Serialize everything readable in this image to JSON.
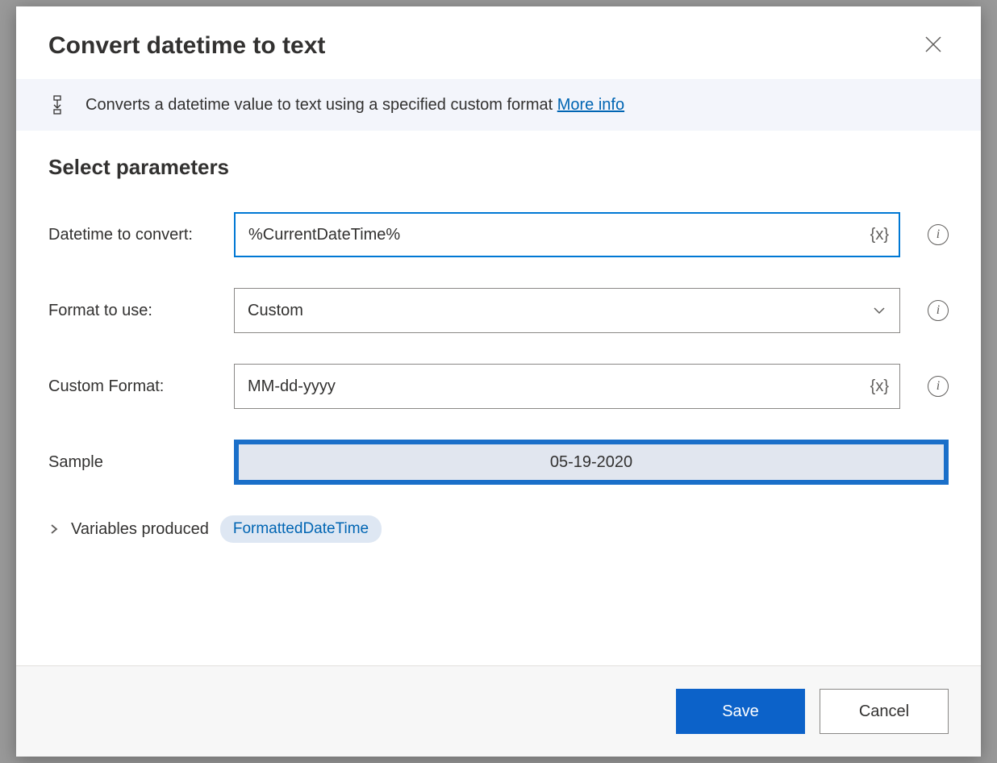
{
  "dialog": {
    "title": "Convert datetime to text",
    "banner": {
      "text": "Converts a datetime value to text using a specified custom format ",
      "more_link": "More info"
    },
    "section_title": "Select parameters",
    "fields": {
      "datetime_label": "Datetime to convert:",
      "datetime_value": "%CurrentDateTime%",
      "datetime_suffix": "{x}",
      "format_label": "Format to use:",
      "format_value": "Custom",
      "custom_format_label": "Custom Format:",
      "custom_format_value": "MM-dd-yyyy",
      "custom_format_suffix": "{x}",
      "sample_label": "Sample",
      "sample_value": "05-19-2020"
    },
    "variables": {
      "label": "Variables produced",
      "chip": "FormattedDateTime"
    },
    "footer": {
      "save": "Save",
      "cancel": "Cancel"
    }
  }
}
